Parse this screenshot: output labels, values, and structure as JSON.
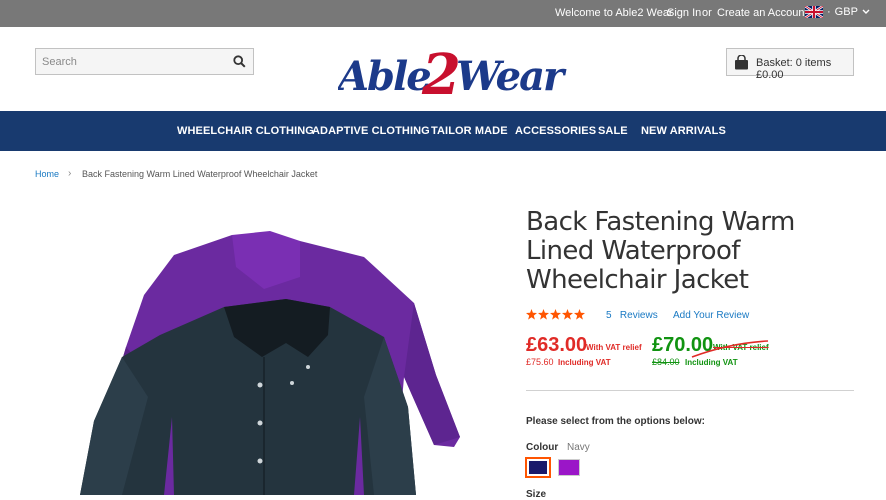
{
  "topbar": {
    "welcome": "Welcome to Able2 Wear",
    "sign_in": "Sign In",
    "or": "or",
    "create_account": "Create an Account",
    "currency": "GBP"
  },
  "header": {
    "search_placeholder": "Search",
    "logo_text": "Able2Wear",
    "basket_label": "Basket: 0 items £0.00"
  },
  "nav": {
    "items": [
      "WHEELCHAIR CLOTHING",
      "ADAPTIVE CLOTHING",
      "TAILOR MADE",
      "ACCESSORIES",
      "SALE",
      "NEW ARRIVALS"
    ]
  },
  "breadcrumb": {
    "home": "Home",
    "current": "Back Fastening Warm Lined Waterproof Wheelchair Jacket"
  },
  "product": {
    "title": "Back Fastening Warm Lined Waterproof Wheelchair Jacket",
    "rating": 5,
    "rating_max": 5,
    "reviews_count": "5",
    "reviews_label": "Reviews",
    "add_review": "Add Your Review",
    "price": "£63.00",
    "price_note": "With VAT relief",
    "price_inc": "£75.60",
    "price_inc_note": "Including VAT",
    "old_price": "£70.00",
    "old_price_note": "With VAT relief",
    "old_price_inc": "£84.00",
    "old_price_inc_note": "Including VAT",
    "options_heading": "Please select from the options below:",
    "colour_label": "Colour",
    "colour_value": "Navy",
    "size_label": "Size"
  },
  "colors": {
    "nav_bg": "#183a6f",
    "topbar_bg": "#787878",
    "price_red": "#e02b27",
    "price_green": "#119311",
    "link_blue": "#1979c3",
    "swatch_navy": "#1a1a6b",
    "swatch_purple": "#9b16c8"
  }
}
